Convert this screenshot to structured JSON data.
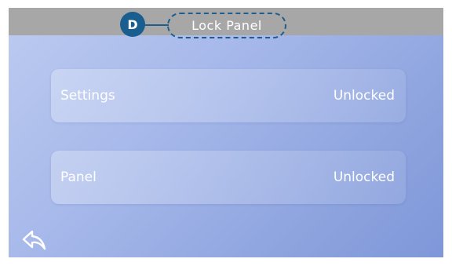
{
  "header": {
    "title": "Lock Panel",
    "marker": "D"
  },
  "rows": [
    {
      "label": "Settings",
      "value": "Unlocked"
    },
    {
      "label": "Panel",
      "value": "Unlocked"
    }
  ],
  "footer": {
    "back_icon": "back-arrow-icon"
  },
  "colors": {
    "titlebar": "#a7a7a8",
    "marker": "#1a5e8f",
    "screen_light": "#bccbf0",
    "screen_dark": "#7f97d9"
  }
}
